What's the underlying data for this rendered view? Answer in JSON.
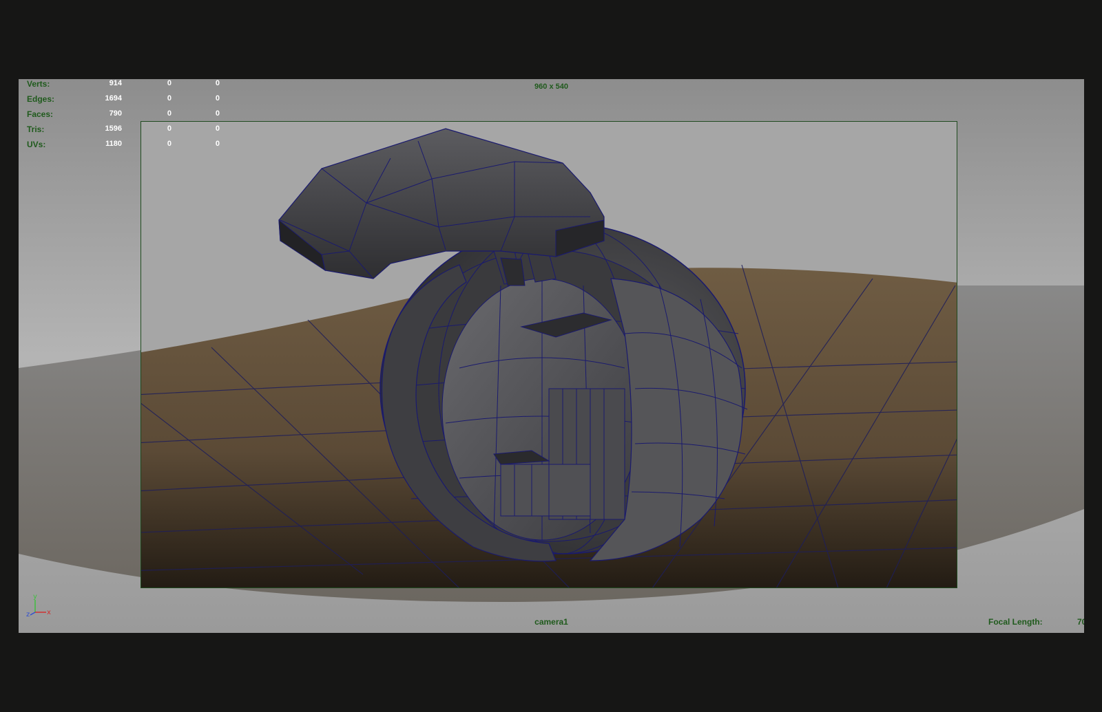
{
  "stats": {
    "rows": [
      {
        "label": "Verts:",
        "values": [
          "914",
          "0",
          "0"
        ]
      },
      {
        "label": "Edges:",
        "values": [
          "1694",
          "0",
          "0"
        ]
      },
      {
        "label": "Faces:",
        "values": [
          "790",
          "0",
          "0"
        ]
      },
      {
        "label": "Tris:",
        "values": [
          "1596",
          "0",
          "0"
        ]
      },
      {
        "label": "UVs:",
        "values": [
          "1180",
          "0",
          "0"
        ]
      }
    ]
  },
  "viewport": {
    "resolution": "960 x 540",
    "camera": "camera1",
    "focal_length_label": "Focal Length:",
    "focal_length_value": "70"
  },
  "axis": {
    "y_label": "y",
    "z_label": "z",
    "x_label": "x"
  },
  "colors": {
    "hud_text": "#1f5a1c",
    "stat_values": "#ffffff",
    "background_outer": "#161615",
    "wireframe": "#1a1a6e",
    "ground": "#6b5a43"
  }
}
